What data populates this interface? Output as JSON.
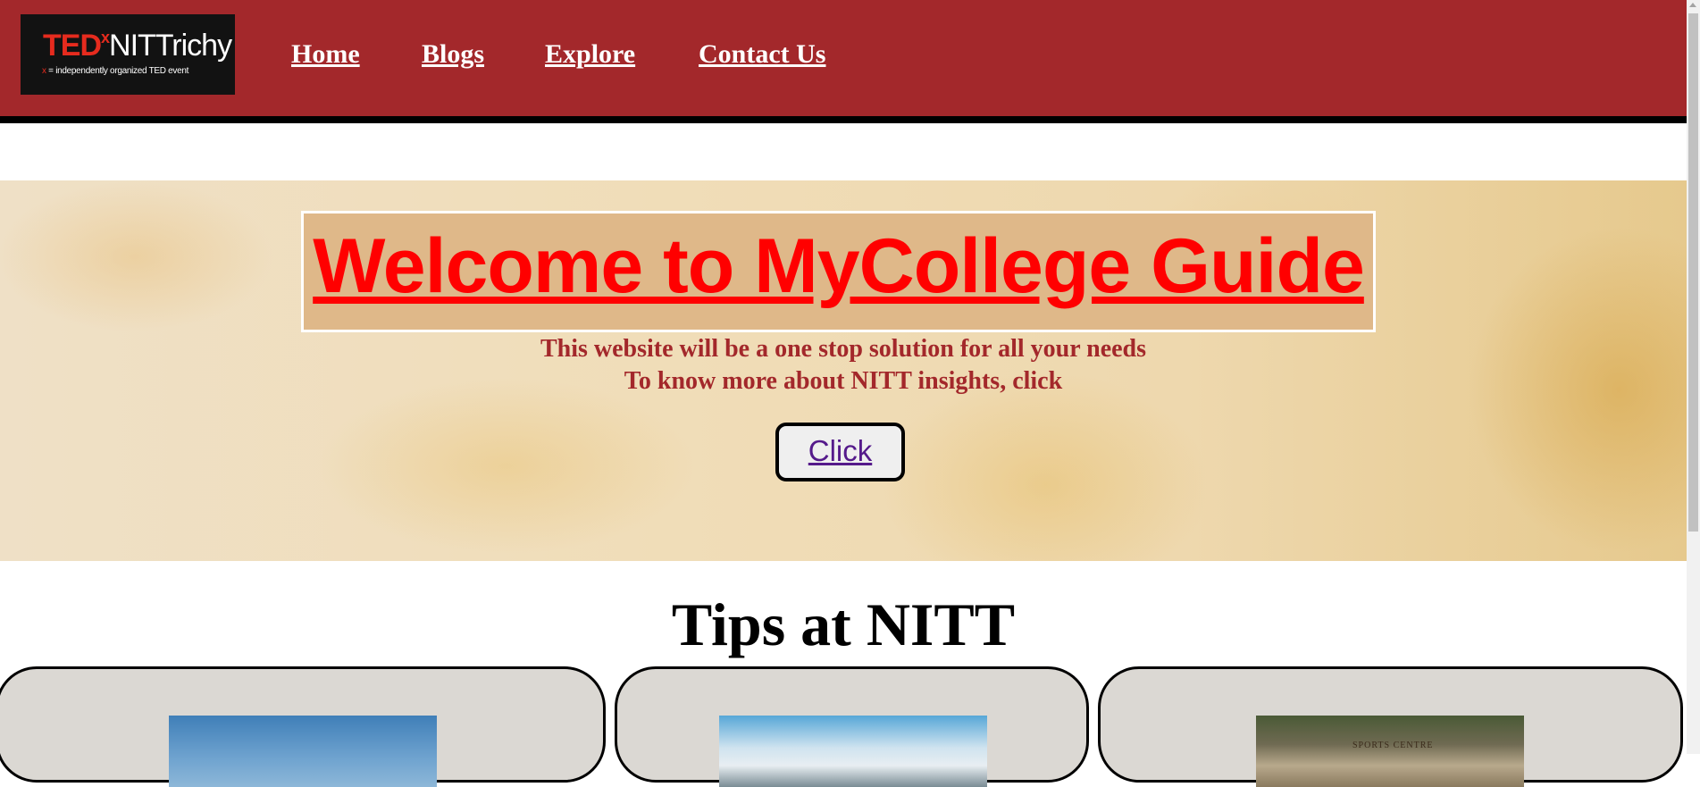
{
  "header": {
    "logo": {
      "brand_ted": "TED",
      "brand_x": "x",
      "brand_event": "NITTrichy",
      "tagline_x": "x",
      "tagline": " = independently organized TED event"
    },
    "nav": [
      "Home",
      "Blogs",
      "Explore",
      "Contact Us"
    ]
  },
  "hero": {
    "title": "Welcome to MyCollege Guide",
    "line1": "This website will be a one stop solution for all your needs",
    "line2": "To know more about NITT insights, click",
    "button_label": "Click"
  },
  "tips": {
    "title": "Tips at NITT",
    "cards": [
      {
        "image": "sky-campus-photo"
      },
      {
        "image": "building-photo"
      },
      {
        "image": "sports-centre-photo",
        "sign_text": "SPORTS CENTRE"
      }
    ]
  }
}
